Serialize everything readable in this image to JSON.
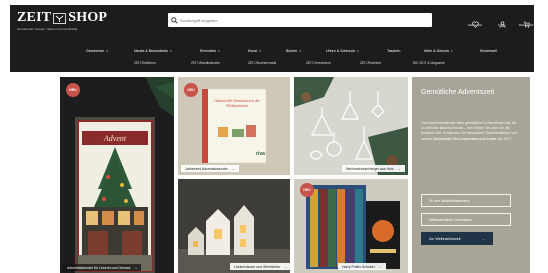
{
  "header": {
    "logo_word1": "ZEIT",
    "logo_word2": "SHOP",
    "tagline": "Gemeinsam besser, zeitlos und nachhaltig",
    "search": {
      "placeholder": "Suchbegriff eingeben"
    },
    "utility": [
      {
        "icon": "heart-icon",
        "label": "Merkzettel"
      },
      {
        "icon": "user-icon",
        "label": "Konto"
      },
      {
        "icon": "cart-icon",
        "label": "Warenkorb"
      }
    ]
  },
  "nav_primary": [
    {
      "label": "Geschenke",
      "has_menu": true
    },
    {
      "label": "Neues & Besonderes",
      "has_menu": true
    },
    {
      "label": "Einrichten",
      "has_menu": true
    },
    {
      "label": "Kunst",
      "has_menu": true
    },
    {
      "label": "Bücher",
      "has_menu": true
    },
    {
      "label": "Uhren & Schmuck",
      "has_menu": true
    },
    {
      "label": "Taschen",
      "has_menu": false
    },
    {
      "label": "Wein & Genuss",
      "has_menu": true
    },
    {
      "label": "Kinderwelt",
      "has_menu": false
    }
  ],
  "nav_secondary": [
    {
      "label": "ZEIT-Editionen"
    },
    {
      "label": "ZEIT-Wandkalender"
    },
    {
      "label": "ZEIT-Wochenmarkt"
    },
    {
      "label": "ZEIT-Verbrechen"
    },
    {
      "label": "ZEIT-Rubriken"
    },
    {
      "label": "DIE ZEIT & Magazine"
    }
  ],
  "tiles": [
    {
      "badge": "NEU",
      "caption": "Adventskalender für Leserin und Genuss"
    },
    {
      "badge": "NEU",
      "caption": "Jahreszeit Adventskalender",
      "book_text": "Genussvolle Jahreszeiten in der Weihnachtszeit"
    },
    {
      "caption": "Weihnachtsanhänger aus Holz"
    },
    {
      "caption": "Lichterhäuser und Windlichter"
    },
    {
      "badge": "NEU",
      "caption": "Harry Potter Schuber"
    }
  ],
  "panel": {
    "title": "Gemütliche Adventszeit",
    "text_intro": "Vom Adventskalender über gemütliche Lichterhäuser bis hin zu stilvoller Baumschmuck – hier finden Sie alles für die festliche Zeit. Entdecken Sie besondere Geschenkideen und unsere",
    "text_bold": "Geschenke für Leserinnen und Leser",
    "text_end": "der ZEIT.",
    "btn1": "Zu den Adventskalendern",
    "btn2": "Weihnachtliche Dekoration",
    "btn3": "Zur Weihnachtswelt"
  },
  "colors": {
    "header_bg": "#1c1c1c",
    "panel_bg": "#a8a598",
    "badge": "#c8534a",
    "cta": "#1f3447"
  }
}
